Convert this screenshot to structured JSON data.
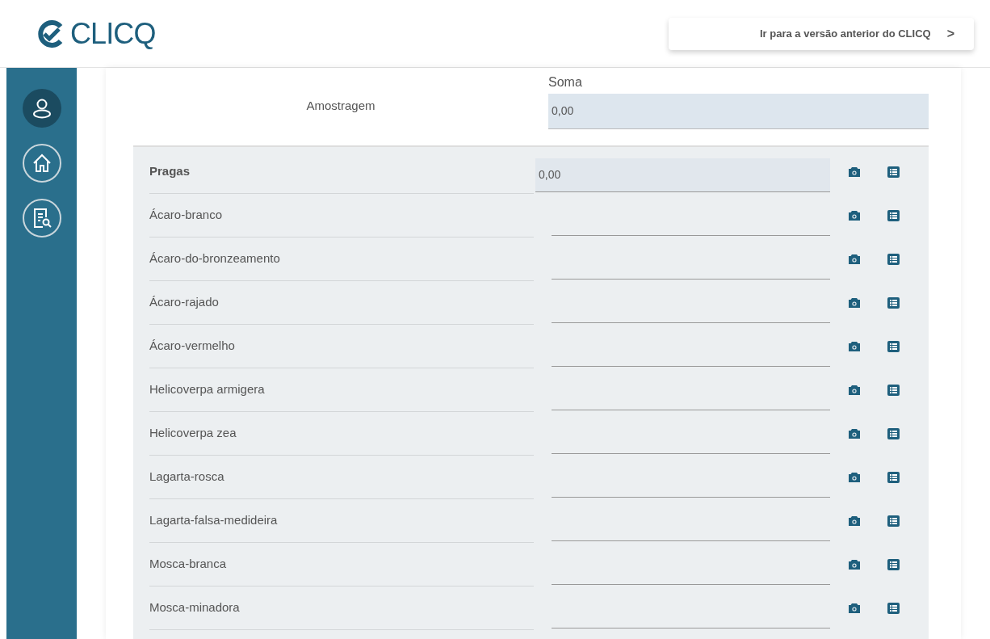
{
  "header": {
    "logo": "CLICQ",
    "back_link": "Ir para a versão anterior do CLICQ",
    "back_arrow": ">"
  },
  "sidebar": {
    "items": [
      {
        "kind": "profile",
        "selected": true
      },
      {
        "kind": "home",
        "selected": false
      },
      {
        "kind": "search-report",
        "selected": false
      }
    ]
  },
  "summary": {
    "label": "Amostragem",
    "field_label": "Soma",
    "value": "0,00"
  },
  "rows": [
    {
      "kind": "group",
      "label": "Pragas",
      "value": "0,00"
    },
    {
      "kind": "item",
      "label": "Ácaro-branco"
    },
    {
      "kind": "item",
      "label": "Ácaro-do-bronzeamento"
    },
    {
      "kind": "item",
      "label": "Ácaro-rajado"
    },
    {
      "kind": "item",
      "label": "Ácaro-vermelho"
    },
    {
      "kind": "item",
      "label": "Helicoverpa armigera"
    },
    {
      "kind": "item",
      "label": "Helicoverpa zea"
    },
    {
      "kind": "item",
      "label": "Lagarta-rosca"
    },
    {
      "kind": "item",
      "label": "Lagarta-falsa-medideira"
    },
    {
      "kind": "item",
      "label": "Mosca-branca"
    },
    {
      "kind": "item",
      "label": "Mosca-minadora"
    }
  ]
}
